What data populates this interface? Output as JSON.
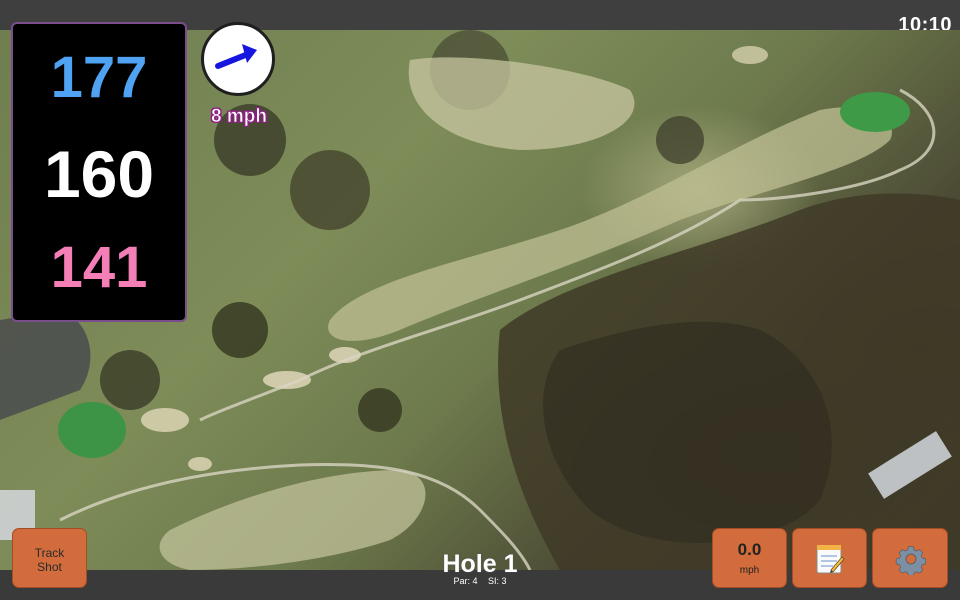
{
  "status": {
    "time": "10:10"
  },
  "yardage": {
    "back": "177",
    "center": "160",
    "front": "141"
  },
  "wind": {
    "speed_label": "8 mph",
    "icon": "arrow-icon",
    "arrow_color": "#1616e0"
  },
  "hole": {
    "title": "Hole 1",
    "par_label": "Par: 4",
    "si_label": "SI: 3"
  },
  "buttons": {
    "track_shot_label": "Track\nShot",
    "speed_value": "0.0",
    "speed_unit": "mph",
    "notes_icon": "notepad-icon",
    "settings_icon": "gear-icon"
  },
  "colors": {
    "button_bg": "#d26c3c",
    "back_yardage": "#4fa3f2",
    "front_yardage": "#f47fb7",
    "panel_border": "#7a4e8c"
  }
}
